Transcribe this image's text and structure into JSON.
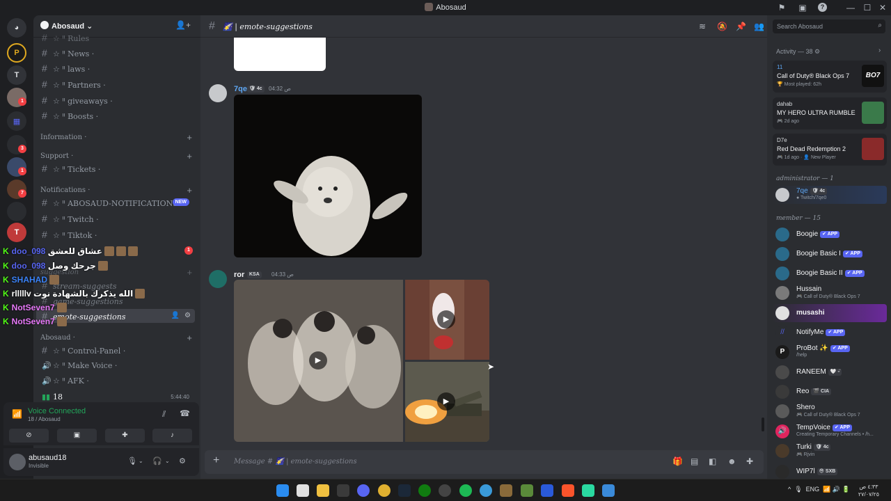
{
  "window": {
    "title": "Abosaud"
  },
  "server": {
    "name": "Abosaud",
    "channels_top": [
      "☆ ᐦ Rules",
      "☆ ᐦ News ·",
      "☆ ᐦ laws ·",
      "☆ ᐦ Partners ·",
      "☆ ᐦ giveaways ·",
      "☆ ᐦ Boosts ·"
    ],
    "cat_information": "Information ·",
    "cat_support": "Support ·",
    "ch_tickets": "☆ ᐦ Tickets ·",
    "cat_notifications": "Notifications ·",
    "ch_notif": "☆ ᐦ ABOSAUD-NOTIFICATIONS ·",
    "new_badge": "NEW",
    "ch_twitch": "☆ ᐦ Twitch ·",
    "ch_tiktok": "☆ ᐦ Tiktok ·",
    "cat_suggestion": "suggestion",
    "ch_stream": "stream-suggests",
    "ch_game": "game-suggestions",
    "ch_emote": "emote-suggestions",
    "cat_abosaud": "Abosaud ·",
    "ch_control": "☆ ᐦ Control-Panel ·",
    "ch_makevoice": "☆ ᐦ Make Voice ·",
    "ch_afk": "☆ ᐦ AFK ·",
    "ch_voice18": "18",
    "voice_timer": "5:44:40",
    "unread_badge": "1"
  },
  "overlay": [
    {
      "user": "doo_098",
      "text": "عشاق للعشق",
      "color": "#5865f2"
    },
    {
      "user": "doo_098",
      "text": "جرحك وصل",
      "color": "#5865f2"
    },
    {
      "user": "SHAHAD",
      "text": "",
      "color": "#3b82f6"
    },
    {
      "user": "rlllllv",
      "text": "الله يذكرك بالشهادة نوت",
      "color": "#ffffff"
    },
    {
      "user": "NotSeven7",
      "text": "",
      "color": "#e879f9"
    },
    {
      "user": "NotSeven7",
      "text": "",
      "color": "#e879f9"
    }
  ],
  "voice": {
    "status": "Voice Connected",
    "location": "18 / Abosaud"
  },
  "user": {
    "name": "abusaud18",
    "status": "Invisible"
  },
  "channel": {
    "name": "emote-suggestions"
  },
  "messages": [
    {
      "author": "7qe",
      "tag": "🛡 4c",
      "time": "04:32 ص",
      "color": "#5fa8f5"
    },
    {
      "author": "ror",
      "tag": "KSA",
      "time": "04:33 ص",
      "color": "#f2f3f5"
    }
  ],
  "composer": {
    "placeholder": "Message # 🌠 | emote-suggestions"
  },
  "right": {
    "search_placeholder": "Search Abosaud",
    "activity_header": "Activity — 38 ⚙",
    "activities": [
      {
        "user": "11",
        "game": "Call of Duty® Black Ops 7",
        "sub": "🏆 Most played: 62h",
        "art": "BO7"
      },
      {
        "user": "dahab",
        "game": "MY HERO ULTRA RUMBLE",
        "sub": "🎮 2d ago",
        "art": ""
      },
      {
        "user": "D7e",
        "game": "Red Dead Redemption 2",
        "sub": "🎮 1d ago · 👤 New Player",
        "art": ""
      }
    ],
    "admin_header": "administrator — 1",
    "admin": {
      "name": "7qe",
      "tag": "🛡 4c",
      "status": "● Twitch/7qe0"
    },
    "member_header": "member — 15",
    "members": [
      {
        "name": "Boogie",
        "badge": "✔ APP",
        "status": ""
      },
      {
        "name": "Boogie Basic I",
        "badge": "✔ APP",
        "status": ""
      },
      {
        "name": "Boogie Basic II",
        "badge": "✔ APP",
        "status": ""
      },
      {
        "name": "Hussain",
        "badge": "",
        "status": "🎮 Call of Duty® Black Ops 7"
      },
      {
        "name": "musashi",
        "badge": "",
        "status": ""
      },
      {
        "name": "NotifyMe",
        "badge": "✔ APP",
        "status": ""
      },
      {
        "name": "ProBot ✨",
        "badge": "✔ APP",
        "status": "/help"
      },
      {
        "name": "RANEEM",
        "badge": "",
        "tag": "🤍 ᵕ̈",
        "status": ""
      },
      {
        "name": "Reo",
        "badge": "",
        "tag": "🎬 CIA",
        "status": ""
      },
      {
        "name": "Shero",
        "badge": "",
        "status": "🎮 Call of Duty® Black Ops 7"
      },
      {
        "name": "TempVoice",
        "badge": "✔ APP",
        "status": "Creating Temporary Channels • /h..."
      },
      {
        "name": "Turki",
        "badge": "",
        "tag": "🛡 4c",
        "status": "🎮 Rjvin"
      },
      {
        "name": "WIP7l",
        "badge": "",
        "tag": "😎 SXB",
        "status": ""
      }
    ]
  },
  "taskbar": {
    "lang": "ENG",
    "time": "٤:٣٣ ص",
    "date": "٢٧/٠٧/٢٥"
  }
}
